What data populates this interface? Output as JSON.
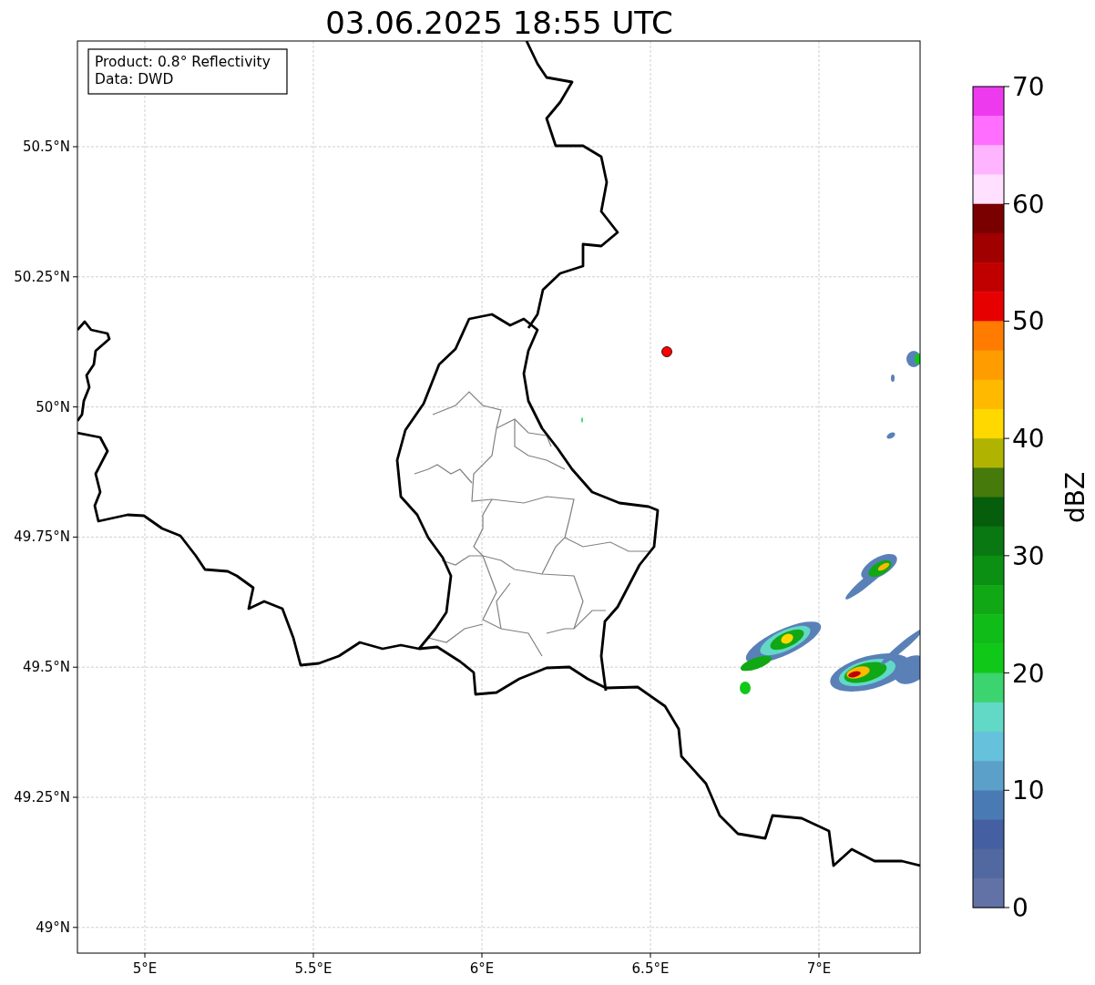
{
  "title": "03.06.2025 18:55 UTC",
  "info_box": {
    "lines": [
      "Product: 0.8° Reflectivity",
      "Data: DWD"
    ]
  },
  "map": {
    "x_ticks": [
      "5°E",
      "5.5°E",
      "6°E",
      "6.5°E",
      "7°E"
    ],
    "y_ticks": [
      "50.5°N",
      "50.25°N",
      "50°N",
      "49.75°N",
      "49.5°N",
      "49.25°N",
      "49°N"
    ]
  },
  "colorbar": {
    "label": "dBZ",
    "ticks": [
      "70",
      "60",
      "50",
      "40",
      "30",
      "20",
      "10",
      "0"
    ],
    "bins": [
      {
        "color": "#ee3aee"
      },
      {
        "color": "#ff6eff"
      },
      {
        "color": "#ffb4ff"
      },
      {
        "color": "#ffe0ff"
      },
      {
        "color": "#7a0000"
      },
      {
        "color": "#a00000"
      },
      {
        "color": "#c00000"
      },
      {
        "color": "#e60000"
      },
      {
        "color": "#ff7c00"
      },
      {
        "color": "#ff9c00"
      },
      {
        "color": "#ffba00"
      },
      {
        "color": "#ffd800"
      },
      {
        "color": "#b0b400"
      },
      {
        "color": "#467a0a"
      },
      {
        "color": "#065e0c"
      },
      {
        "color": "#0a7812"
      },
      {
        "color": "#0c9014"
      },
      {
        "color": "#10a814"
      },
      {
        "color": "#10bc18"
      },
      {
        "color": "#10c818"
      },
      {
        "color": "#3cd46e"
      },
      {
        "color": "#62d8c6"
      },
      {
        "color": "#66c2dc"
      },
      {
        "color": "#5ba0c8"
      },
      {
        "color": "#4a7ab4"
      },
      {
        "color": "#4460a2"
      },
      {
        "color": "#5168a0"
      },
      {
        "color": "#6372a6"
      }
    ]
  }
}
